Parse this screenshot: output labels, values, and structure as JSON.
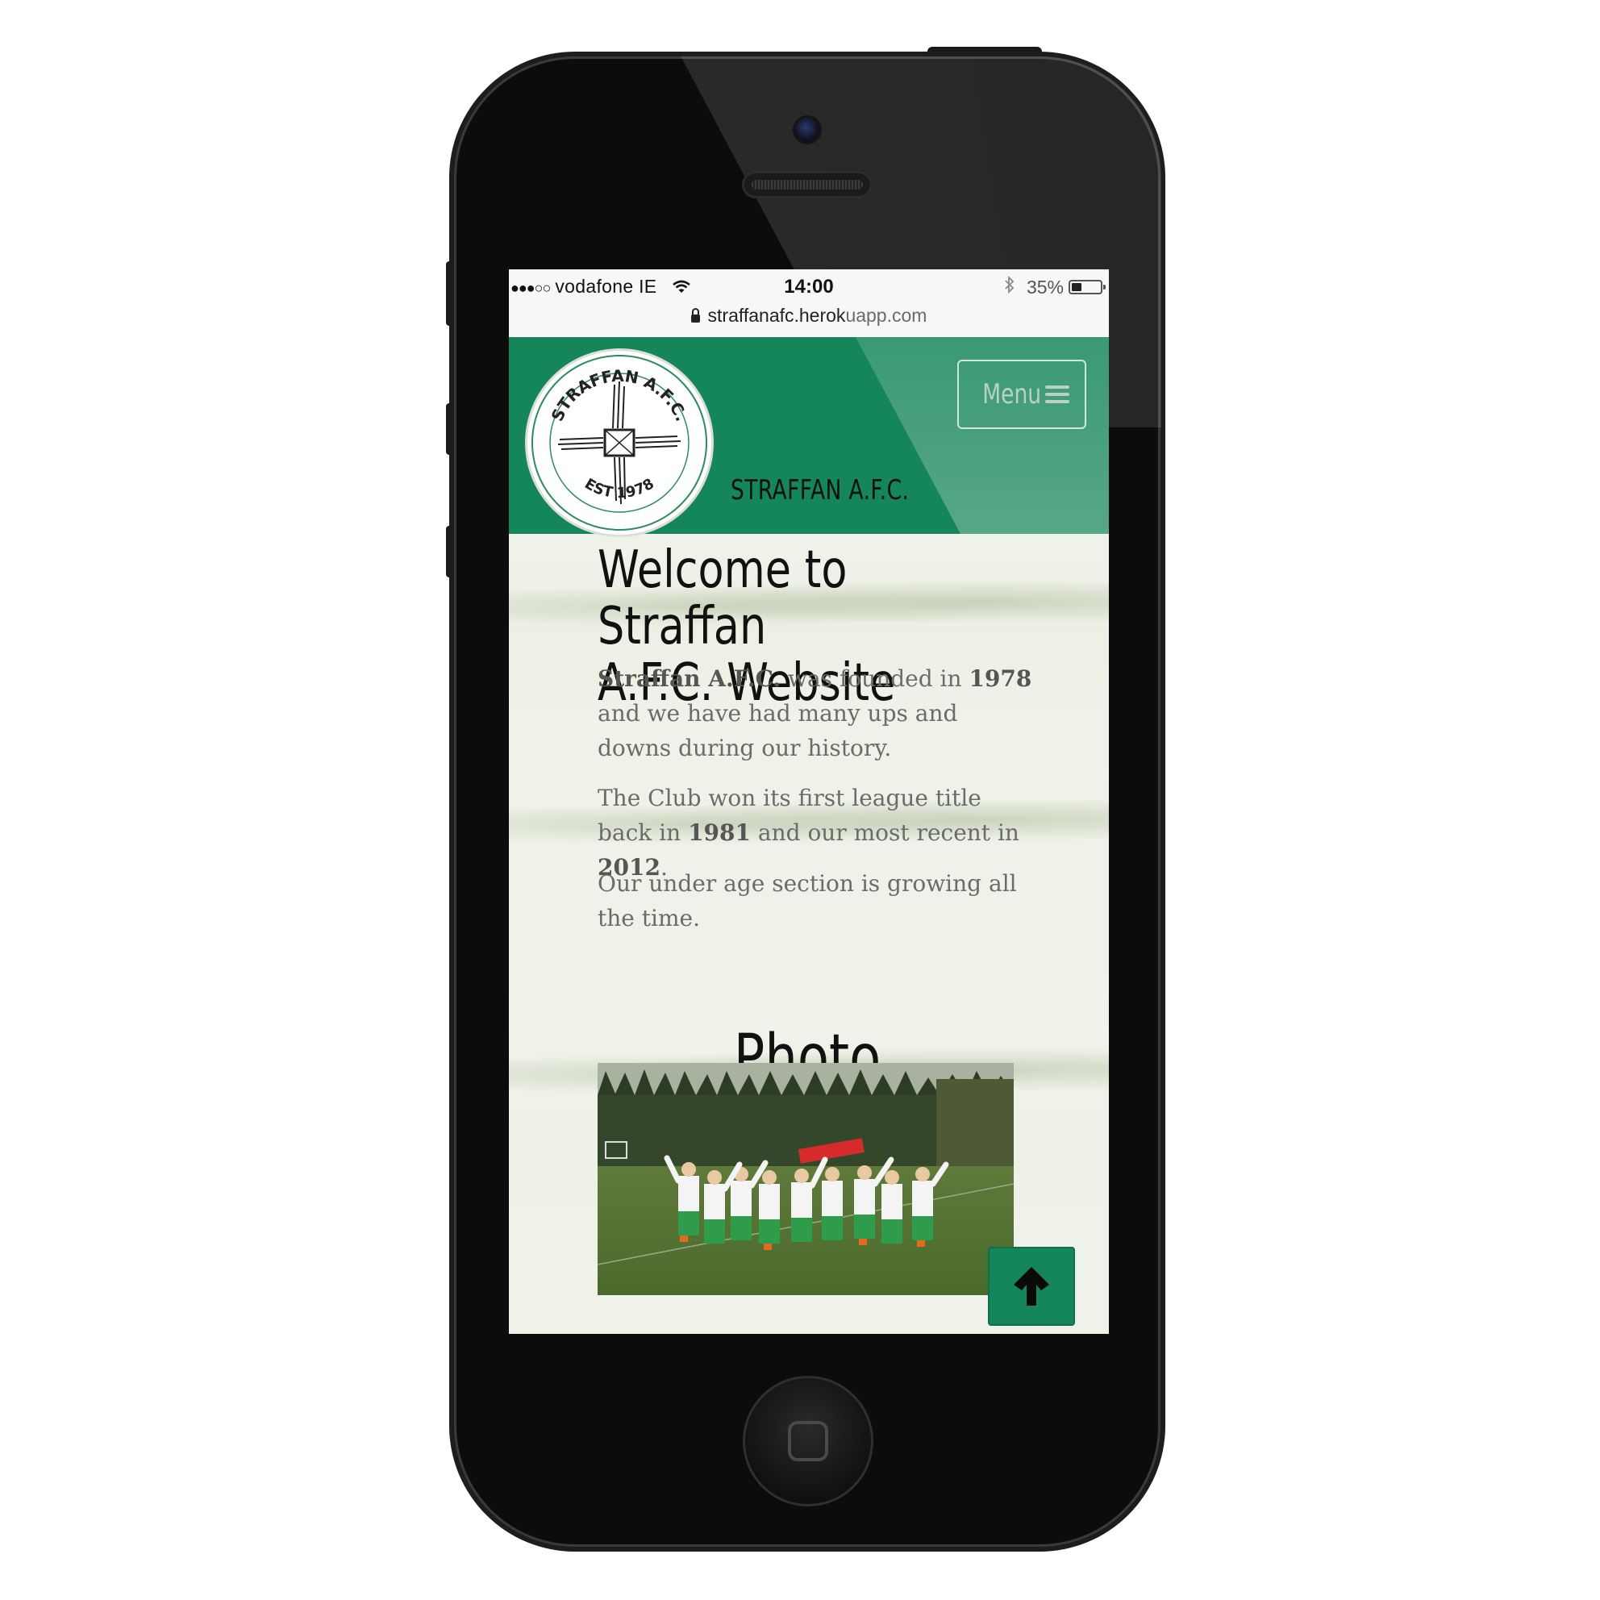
{
  "status_bar": {
    "carrier": "vodafone IE",
    "time": "14:00",
    "battery": "35%",
    "battery_level": 0.35
  },
  "url_bar": {
    "domain": "straffanafc.herok",
    "rest": "uapp.com"
  },
  "navbar": {
    "brand": "STRAFFAN A.F.C.",
    "menu_label": "Menu",
    "logo_text_top": "STRAFFAN A.F.C.",
    "logo_text_bottom": "EST 1978"
  },
  "welcome": {
    "heading_line1": "Welcome to Straffan",
    "heading_line2": "A.F.C. Website",
    "p1_bold1": "Straffan A.F.C.",
    "p1_text1": " was founded in ",
    "p1_bold2": "1978",
    "p1_text2": " and we have had many ups and downs during our history.",
    "p2_text1": "The Club won its first league title back in ",
    "p2_bold1": "1981",
    "p2_text2": " and our most recent in ",
    "p2_bold2": "2012",
    "p2_text3": ".",
    "p3_text": "Our under age section is growing all the time."
  },
  "gallery": {
    "title": "Photo Gallery"
  },
  "icons": {
    "menu": "hamburger-icon",
    "back_to_top": "arrow-up-icon",
    "secure": "lock-icon",
    "wifi": "wifi-icon",
    "bluetooth": "bluetooth-icon"
  },
  "colors": {
    "brand_green": "#15855a"
  }
}
